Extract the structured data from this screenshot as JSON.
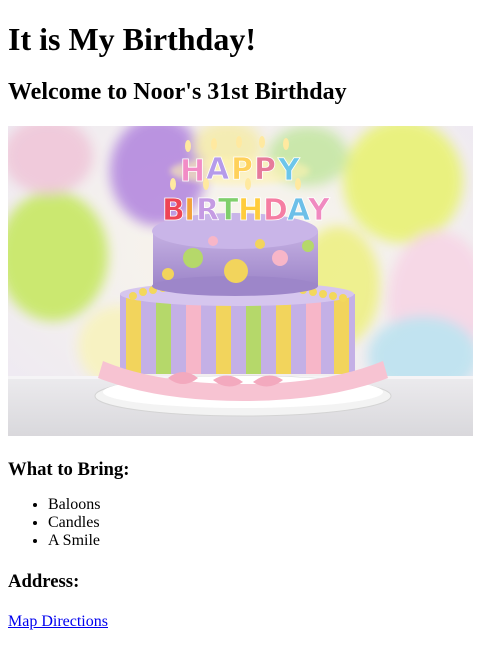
{
  "page": {
    "title": "It is My Birthday!",
    "welcome": "Welcome to Noor's 31st Birthday"
  },
  "image": {
    "description_icon": "birthday-cake-image",
    "cake_topper_letters": [
      "H",
      "A",
      "P",
      "P",
      "Y",
      "B",
      "I",
      "R",
      "T",
      "H",
      "D",
      "A",
      "Y"
    ]
  },
  "bring": {
    "heading": "What to Bring:",
    "items": [
      "Baloons",
      "Candles",
      "A Smile"
    ]
  },
  "address": {
    "heading": "Address:",
    "link_label": "Map Directions"
  },
  "colors": {
    "link": "#0000ee",
    "cake_purple": "#b39ddb",
    "cake_yellow": "#f2d45c",
    "cake_green": "#b5d86a",
    "cake_pink": "#f7b6c8"
  }
}
